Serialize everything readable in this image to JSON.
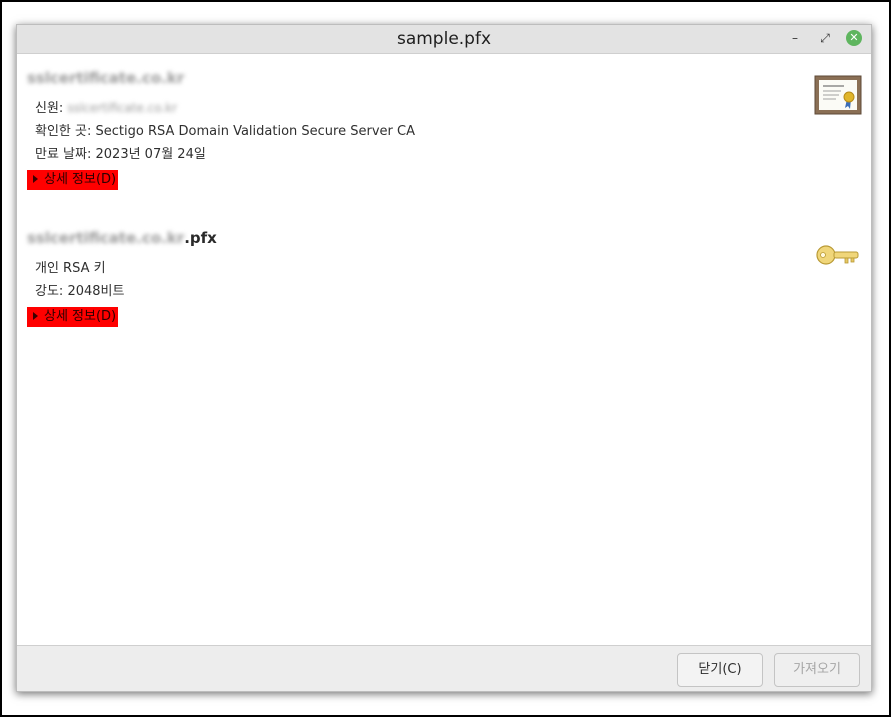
{
  "window": {
    "title": "sample.pfx"
  },
  "certificate": {
    "name": "sslcertificate.co.kr",
    "identity_label": "신원: ",
    "identity_value": "sslcertificate.co.kr",
    "issuer_label": "확인한 곳: ",
    "issuer_value": "Sectigo RSA Domain Validation Secure Server CA",
    "expiry_label": "만료 날짜: ",
    "expiry_value": "2023년 07월 24일",
    "details_label": "상세 정보(D)",
    "icon": "certificate-icon"
  },
  "key": {
    "name_blurred": "sslcertificate.co.kr",
    "name_suffix": ".pfx",
    "type_text": "개인 RSA 키",
    "strength_label": "강도: ",
    "strength_value": "2048비트",
    "details_label": "상세 정보(D)",
    "icon": "key-icon"
  },
  "buttons": {
    "close_label": "닫기(C)",
    "import_label": "가져오기"
  }
}
